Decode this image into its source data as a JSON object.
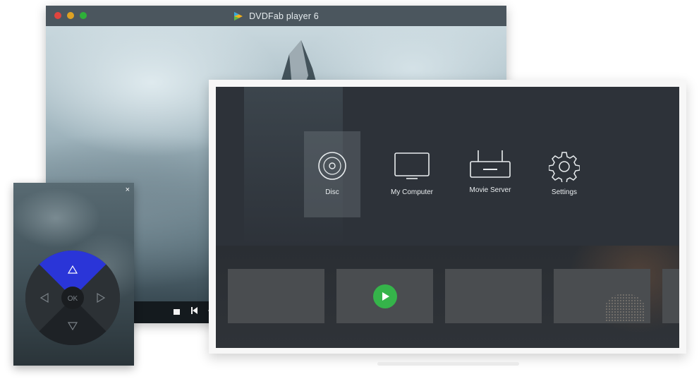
{
  "window": {
    "title": "DVDFab player 6"
  },
  "player_controls": {
    "stop_icon": "stop-icon",
    "prev_icon": "skip-back-icon",
    "rewind_icon": "rewind-icon"
  },
  "home_menu": {
    "items": [
      {
        "label": "Disc",
        "icon": "disc-icon",
        "selected": true
      },
      {
        "label": "My Computer",
        "icon": "monitor-icon",
        "selected": false
      },
      {
        "label": "Movie Server",
        "icon": "router-icon",
        "selected": false
      },
      {
        "label": "Settings",
        "icon": "gear-icon",
        "selected": false
      }
    ]
  },
  "thumbnails": {
    "count_visible": 5,
    "play_icon": "play-icon"
  },
  "remote": {
    "close_glyph": "×",
    "ok_label": "OK",
    "up_icon": "triangle-up-icon",
    "left_icon": "triangle-left-icon",
    "right_icon": "triangle-right-icon",
    "down_icon": "triangle-down-icon"
  },
  "colors": {
    "accent_remote": "#2a35d8",
    "play_green": "#35b44a",
    "titlebar": "#4b565e"
  }
}
